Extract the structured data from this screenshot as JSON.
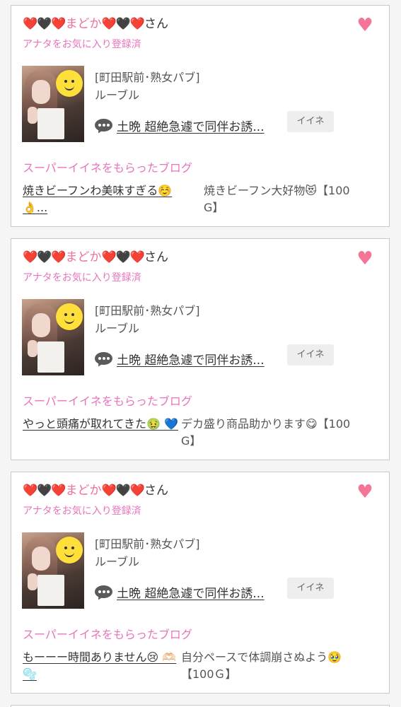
{
  "colors": {
    "accent_pink": "#e774bd",
    "name_pink": "#f06ea0",
    "heart_pink": "#f47595",
    "card_border": "#c9c9c9"
  },
  "cards": [
    {
      "user": {
        "hearts_left": "❤️🖤❤️",
        "name": "まどか",
        "hearts_right": "❤️🖤❤️",
        "suffix": "さん"
      },
      "favorite_status": "アナタをお気に入り登録済",
      "heart_icon": "heart-icon",
      "shop_area": "[町田駅前･熟女パブ]",
      "shop_name": "ルーブル",
      "post_icon": "speech-bubble-icon",
      "post_title": "土晩 超絶急遽で同伴お誘...",
      "iine_label": "イイネ",
      "blog_section_title": "スーパーイイネをもらったブログ",
      "blog_title": "焼きビーフンわ美味すぎる☺️ 👌...",
      "blog_comment": "焼きビーフン大好物😻【100 G】"
    },
    {
      "user": {
        "hearts_left": "❤️🖤❤️",
        "name": "まどか",
        "hearts_right": "❤️🖤❤️",
        "suffix": "さん"
      },
      "favorite_status": "アナタをお気に入り登録済",
      "heart_icon": "heart-icon",
      "shop_area": "[町田駅前･熟女パブ]",
      "shop_name": "ルーブル",
      "post_icon": "speech-bubble-icon",
      "post_title": "土晩 超絶急遽で同伴お誘...",
      "iine_label": "イイネ",
      "blog_section_title": "スーパーイイネをもらったブログ",
      "blog_title": "やっと頭痛が取れてきた🤢 💙",
      "blog_comment": "デカ盛り商品助かります😋【100 G】"
    },
    {
      "user": {
        "hearts_left": "❤️🖤❤️",
        "name": "まどか",
        "hearts_right": "❤️🖤❤️",
        "suffix": "さん"
      },
      "favorite_status": "アナタをお気に入り登録済",
      "heart_icon": "heart-icon",
      "shop_area": "[町田駅前･熟女パブ]",
      "shop_name": "ルーブル",
      "post_icon": "speech-bubble-icon",
      "post_title": "土晩 超絶急遽で同伴お誘...",
      "iine_label": "イイネ",
      "blog_section_title": "スーパーイイネをもらったブログ",
      "blog_title": "もーーー時間ありません😢 🫶🏻🫧",
      "blog_comment": "自分ペースで体調崩さぬよう🥹【100Ｇ】"
    }
  ]
}
